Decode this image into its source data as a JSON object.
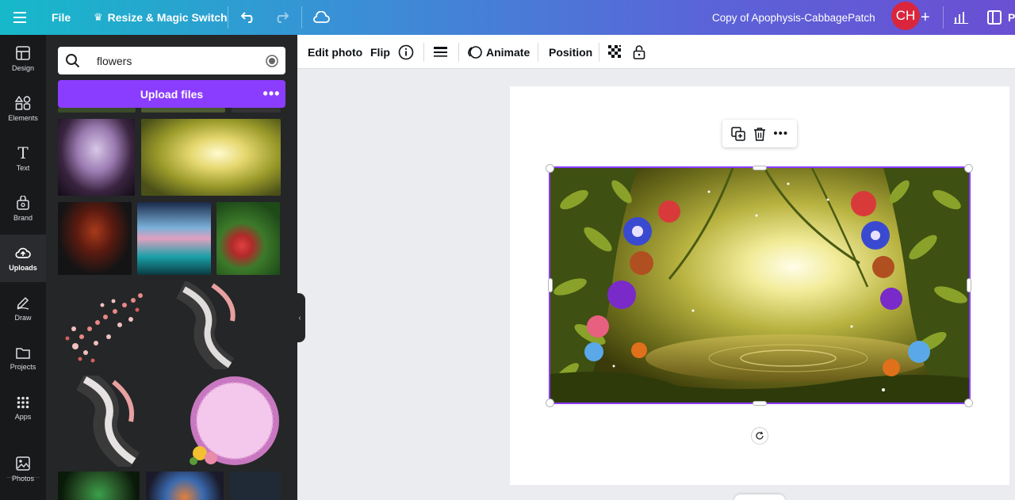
{
  "topbar": {
    "menu_icon": "hamburger-menu-icon",
    "file_label": "File",
    "resize_label": "Resize & Magic Switch",
    "doc_title": "Copy of Apophysis-CabbagePatch",
    "avatar_initials": "CH",
    "truncated_label": "P"
  },
  "rail": {
    "items": [
      {
        "label": "Design",
        "icon": "layout-icon"
      },
      {
        "label": "Elements",
        "icon": "shapes-icon"
      },
      {
        "label": "Text",
        "icon": "text-icon"
      },
      {
        "label": "Brand",
        "icon": "brand-icon"
      },
      {
        "label": "Uploads",
        "icon": "cloud-upload-icon"
      },
      {
        "label": "Draw",
        "icon": "pen-icon"
      },
      {
        "label": "Projects",
        "icon": "folder-icon"
      },
      {
        "label": "Apps",
        "icon": "grid-icon"
      },
      {
        "label": "Photos",
        "icon": "image-icon"
      }
    ],
    "active": "Uploads"
  },
  "panel": {
    "search_value": "flowers",
    "upload_label": "Upload files"
  },
  "toolbar": {
    "edit_photo": "Edit photo",
    "flip": "Flip",
    "animate": "Animate",
    "position": "Position"
  },
  "colors": {
    "accent": "#8b3dff",
    "avatar": "#d9263d",
    "rail_bg": "#18191b",
    "panel_bg": "#252627"
  }
}
